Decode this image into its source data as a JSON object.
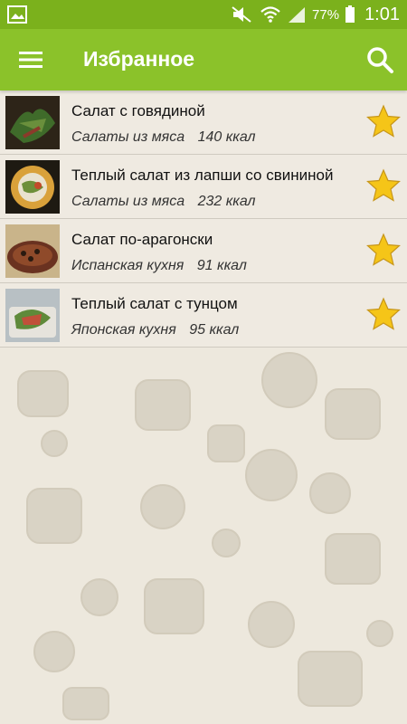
{
  "status_bar": {
    "battery_text": "77%",
    "clock": "1:01"
  },
  "app_bar": {
    "title": "Избранное"
  },
  "colors": {
    "status_bar": "#7bb11c",
    "app_bar": "#8bc22a",
    "star": "#f5c518",
    "background": "#ede8dd"
  },
  "favorites": [
    {
      "name": "Салат с говядиной",
      "category": "Салаты из мяса",
      "calories": "140 ккал",
      "favorited": true
    },
    {
      "name": "Теплый салат из лапши со свининой",
      "category": "Салаты из мяса",
      "calories": "232 ккал",
      "favorited": true
    },
    {
      "name": "Салат по-арагонски",
      "category": "Испанская кухня",
      "calories": "91 ккал",
      "favorited": true
    },
    {
      "name": "Теплый салат с тунцом",
      "category": "Японская кухня",
      "calories": "95 ккал",
      "favorited": true
    }
  ]
}
